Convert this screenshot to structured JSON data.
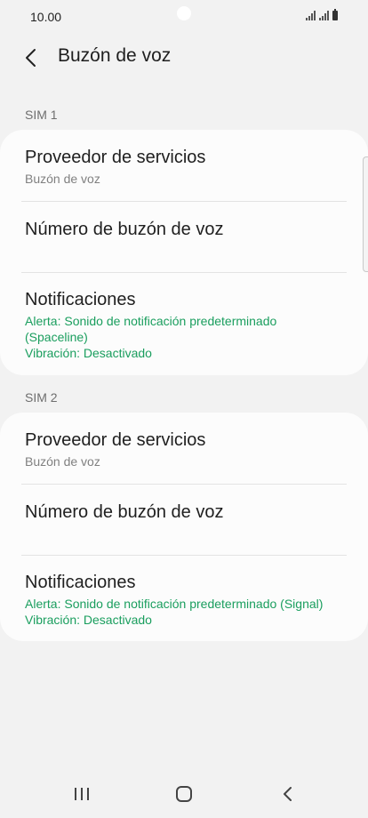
{
  "status_bar": {
    "time": "10.00"
  },
  "header": {
    "title": "Buzón de voz"
  },
  "sim1": {
    "label": "SIM 1",
    "provider_title": "Proveedor de servicios",
    "provider_value": "Buzón de voz",
    "number_title": "Número de buzón de voz",
    "notifications_title": "Notificaciones",
    "notifications_alert_line1": "Alerta: Sonido de notificación predeterminado",
    "notifications_alert_line2": "(Spaceline)",
    "notifications_vibration": "Vibración: Desactivado"
  },
  "sim2": {
    "label": "SIM 2",
    "provider_title": "Proveedor de servicios",
    "provider_value": "Buzón de voz",
    "number_title": "Número de buzón de voz",
    "notifications_title": "Notificaciones",
    "notifications_alert": "Alerta: Sonido de notificación predeterminado (Signal)",
    "notifications_vibration": "Vibración: Desactivado"
  },
  "colors": {
    "accent_green": "#1a9e5e",
    "background": "#f2f2f2",
    "card": "#fcfcfc"
  },
  "icons": {
    "back": "chevron-left-icon",
    "recents": "recents-icon",
    "home": "home-icon",
    "nav_back": "nav-back-icon",
    "battery": "battery-icon",
    "signal": "signal-icon"
  }
}
